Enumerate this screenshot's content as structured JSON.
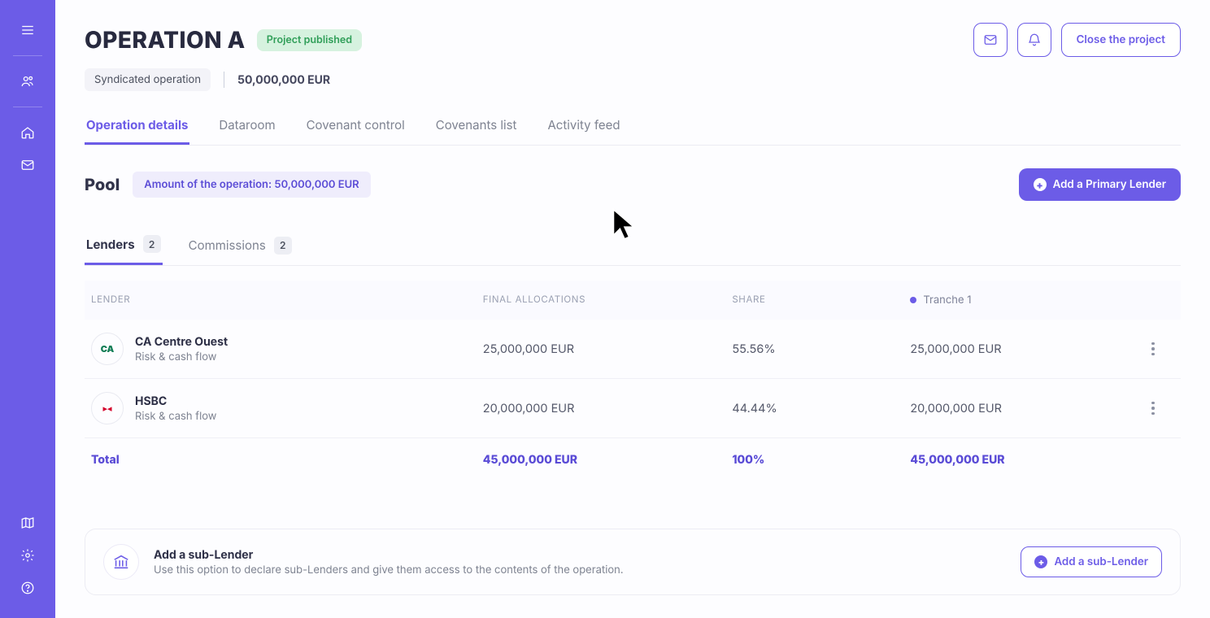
{
  "header": {
    "title": "OPERATION A",
    "status": "Project published",
    "close_label": "Close the project",
    "type_tag": "Syndicated operation",
    "amount": "50,000,000 EUR"
  },
  "tabs": [
    {
      "label": "Operation details",
      "active": true
    },
    {
      "label": "Dataroom"
    },
    {
      "label": "Covenant control"
    },
    {
      "label": "Covenants list"
    },
    {
      "label": "Activity feed"
    }
  ],
  "pool": {
    "title": "Pool",
    "amount_chip": "Amount of the operation: 50,000,000 EUR",
    "add_primary_label": "Add a Primary Lender"
  },
  "subtabs": {
    "lenders_label": "Lenders",
    "lenders_count": "2",
    "commissions_label": "Commissions",
    "commissions_count": "2"
  },
  "table": {
    "headers": {
      "lender": "LENDER",
      "final_alloc": "FINAL ALLOCATIONS",
      "share": "SHARE",
      "tranche": "Tranche 1"
    },
    "rows": [
      {
        "name": "CA Centre Ouest",
        "subtitle": "Risk & cash flow",
        "logo_class": "ca",
        "logo_text": "CA",
        "alloc": "25,000,000 EUR",
        "share": "55.56%",
        "tranche": "25,000,000 EUR"
      },
      {
        "name": "HSBC",
        "subtitle": "Risk & cash flow",
        "logo_class": "hsbc",
        "logo_text": "▸◂",
        "alloc": "20,000,000 EUR",
        "share": "44.44%",
        "tranche": "20,000,000 EUR"
      }
    ],
    "total": {
      "label": "Total",
      "alloc": "45,000,000 EUR",
      "share": "100%",
      "tranche": "45,000,000 EUR"
    }
  },
  "sublender": {
    "title": "Add a sub-Lender",
    "desc": "Use this option to declare sub-Lenders and give them access to the contents of the operation.",
    "button": "Add a sub-Lender"
  }
}
